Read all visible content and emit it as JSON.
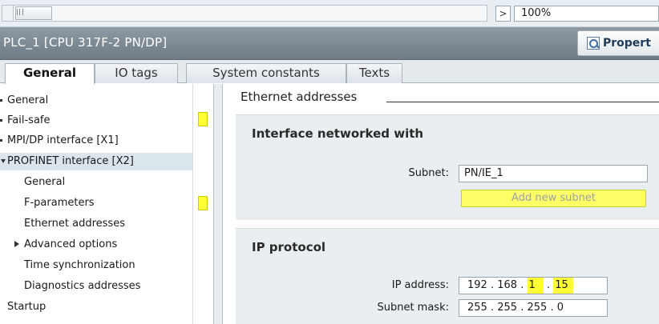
{
  "zoom": {
    "value": "100%",
    "arrow": ">"
  },
  "title": {
    "text": "PLC_1 [CPU 317F-2 PN/DP]",
    "properties_label": "Propert"
  },
  "tabs": [
    {
      "label": "General",
      "active": true
    },
    {
      "label": "IO tags",
      "active": false
    },
    {
      "label": "System constants",
      "active": false
    },
    {
      "label": "Texts",
      "active": false
    }
  ],
  "nav": {
    "items": [
      {
        "label": "General"
      },
      {
        "label": "Fail-safe"
      },
      {
        "label": "MPI/DP interface [X1]"
      },
      {
        "label": "PROFINET interface [X2]"
      },
      {
        "label": "General"
      },
      {
        "label": "F-parameters"
      },
      {
        "label": "Ethernet addresses"
      },
      {
        "label": "Advanced options"
      },
      {
        "label": "Time synchronization"
      },
      {
        "label": "Diagnostics addresses"
      },
      {
        "label": "Startup"
      }
    ]
  },
  "content": {
    "section_title": "Ethernet addresses",
    "interface_group": {
      "title": "Interface networked with",
      "subnet_label": "Subnet:",
      "subnet_value": "PN/IE_1",
      "add_subnet_label": "Add new subnet"
    },
    "ip_group": {
      "title": "IP protocol",
      "ip_label": "IP address:",
      "ip_parts": [
        "192",
        "168",
        "1",
        "15"
      ],
      "mask_label": "Subnet mask:",
      "mask_parts": [
        "255",
        "255",
        "255",
        "0"
      ],
      "separator": "."
    }
  },
  "colors": {
    "highlight": "#ffff33",
    "title_bar": "#7f8b94",
    "group_bg": "#e9eef1",
    "selected_row": "#dbe5ec"
  }
}
